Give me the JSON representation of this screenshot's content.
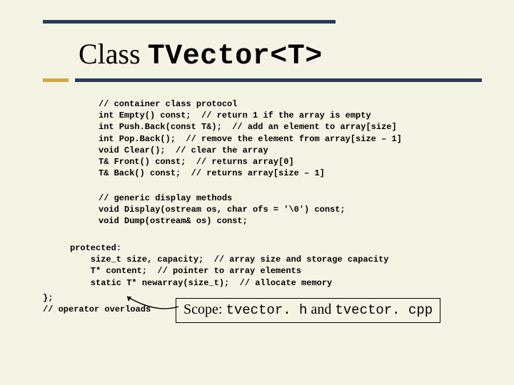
{
  "title": {
    "prefix": "Class ",
    "classname": "TVector<T>"
  },
  "code": {
    "block1": "// container class protocol\nint Empty() const;  // return 1 if the array is empty\nint Push.Back(const T&);  // add an element to array[size]\nint Pop.Back();  // remove the element from array[size – 1]\nvoid Clear();  // clear the array\nT& Front() const;  // returns array[0]\nT& Back() const;  // returns array[size – 1]",
    "block2": "// generic display methods\nvoid Display(ostream os, char ofs = '\\0') const;\nvoid Dump(ostream& os) const;",
    "block3": "protected:\n    size_t size, capacity;  // array size and storage capacity\n    T* content;  // pointer to array elements\n    static T* newarray(size_t);  // allocate memory",
    "block4": "};\n// operator overloads"
  },
  "scope": {
    "label": "Scope: ",
    "file1": "tvector. h",
    "joiner": " and ",
    "file2": "tvector. cpp"
  }
}
